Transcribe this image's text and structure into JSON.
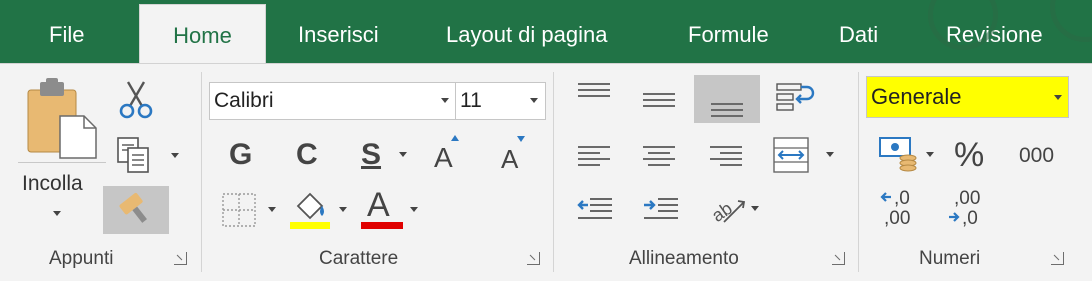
{
  "tabs": [
    {
      "label": "File"
    },
    {
      "label": "Home"
    },
    {
      "label": "Inserisci"
    },
    {
      "label": "Layout di pagina"
    },
    {
      "label": "Formule"
    },
    {
      "label": "Dati"
    },
    {
      "label": "Revisione"
    }
  ],
  "clipboard": {
    "paste_label": "Incolla",
    "group_label": "Appunti"
  },
  "font": {
    "font_name": "Calibri",
    "font_size": "11",
    "bold_label": "G",
    "italic_label": "C",
    "underline_label": "S",
    "grow_label": "A",
    "shrink_label": "A",
    "font_color_label": "A",
    "fill_color": "#ffff00",
    "font_color": "#e00000",
    "group_label": "Carattere"
  },
  "alignment": {
    "group_label": "Allineamento"
  },
  "number": {
    "format_value": "Generale",
    "highlight_color": "#ffff00",
    "percent_label": "%",
    "comma_label": "000",
    "increase_decimal_top": ",0",
    "increase_decimal_bottom": ",00",
    "decrease_decimal_top": ",00",
    "decrease_decimal_bottom": ",0",
    "group_label": "Numeri"
  },
  "accent_color": "#217346"
}
